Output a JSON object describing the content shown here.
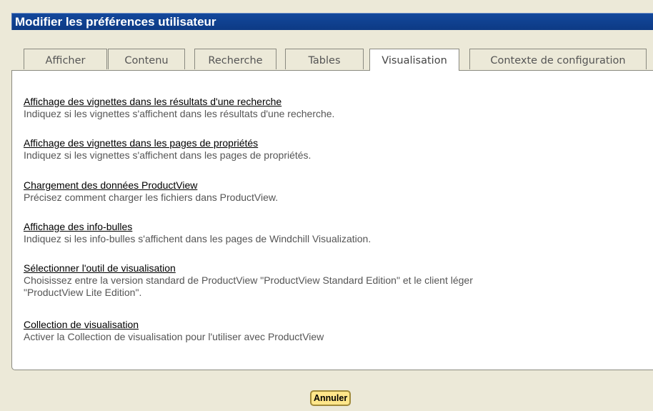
{
  "header": {
    "title": "Modifier les préférences utilisateur"
  },
  "tabs": [
    {
      "label": "Afficher",
      "active": false
    },
    {
      "label": "Contenu",
      "active": false
    },
    {
      "label": "Recherche",
      "active": false
    },
    {
      "label": "Tables",
      "active": false
    },
    {
      "label": "Visualisation",
      "active": true
    },
    {
      "label": "Contexte de configuration",
      "active": false
    }
  ],
  "preferences": [
    {
      "title": "Affichage des vignettes dans les résultats d'une recherche",
      "description": "Indiquez si les vignettes s'affichent dans les résultats d'une recherche."
    },
    {
      "title": "Affichage des vignettes dans les pages de propriétés",
      "description": "Indiquez si les vignettes s'affichent dans les pages de propriétés."
    },
    {
      "title": "Chargement des données ProductView",
      "description": "Précisez comment charger les fichiers dans ProductView."
    },
    {
      "title": "Affichage des info-bulles",
      "description": "Indiquez si les info-bulles s'affichent dans les pages de Windchill Visualization."
    },
    {
      "title": "Sélectionner l'outil de visualisation",
      "description_line1": "Choisissez entre la version standard de ProductView \"ProductView Standard Edition\" et le client léger",
      "description_line2": "\"ProductView Lite Edition\"."
    },
    {
      "title": "Collection de visualisation",
      "description": "Activer la Collection de visualisation pour l'utiliser avec ProductView"
    }
  ],
  "footer": {
    "cancel_label": "Annuler"
  },
  "colors": {
    "title_bar": "#13489c",
    "background": "#ece9d8",
    "button": "#ffe68a"
  }
}
